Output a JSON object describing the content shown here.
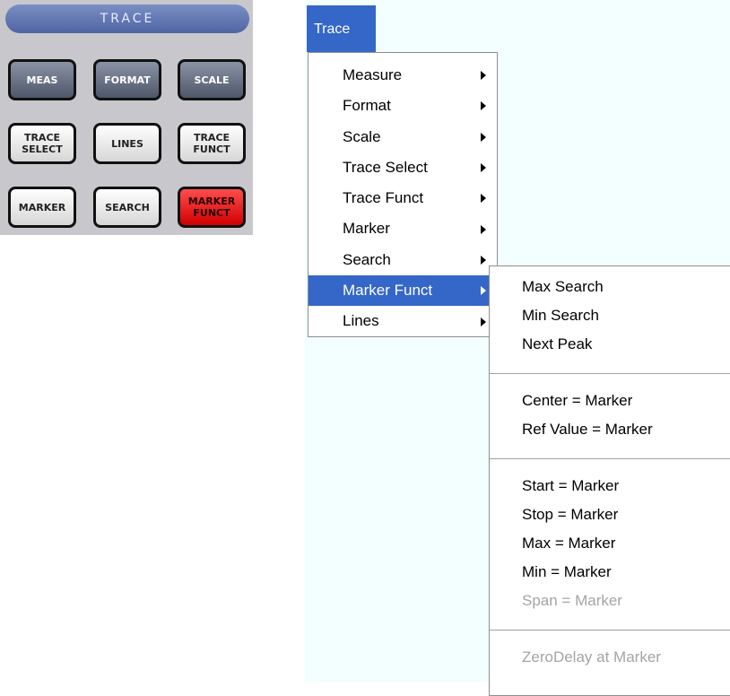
{
  "panel": {
    "title": "TRACE",
    "buttons": {
      "meas": "MEAS",
      "format": "FORMAT",
      "scale": "SCALE",
      "trace_select": "TRACE\nSELECT",
      "lines": "LINES",
      "trace_funct": "TRACE\nFUNCT",
      "marker": "MARKER",
      "search": "SEARCH",
      "marker_funct": "MARKER\nFUNCT"
    }
  },
  "menubar": {
    "trace": "Trace"
  },
  "menu": {
    "items": [
      "Measure",
      "Format",
      "Scale",
      "Trace Select",
      "Trace Funct",
      "Marker",
      "Search",
      "Marker Funct",
      "Lines"
    ],
    "selected": "Marker Funct"
  },
  "submenu": {
    "items": [
      "Max Search",
      "Min Search",
      "Next Peak",
      "Center = Marker",
      "Ref Value = Marker",
      "Start = Marker",
      "Stop = Marker",
      "Max = Marker",
      "Min = Marker",
      "Span = Marker",
      "ZeroDelay at Marker"
    ],
    "disabled": [
      "Span = Marker",
      "ZeroDelay at Marker"
    ]
  },
  "colors": {
    "menu_highlight": "#3567c9",
    "marker_funct_key": "#ff2a2a",
    "panel_header": "#5a6fb0"
  }
}
